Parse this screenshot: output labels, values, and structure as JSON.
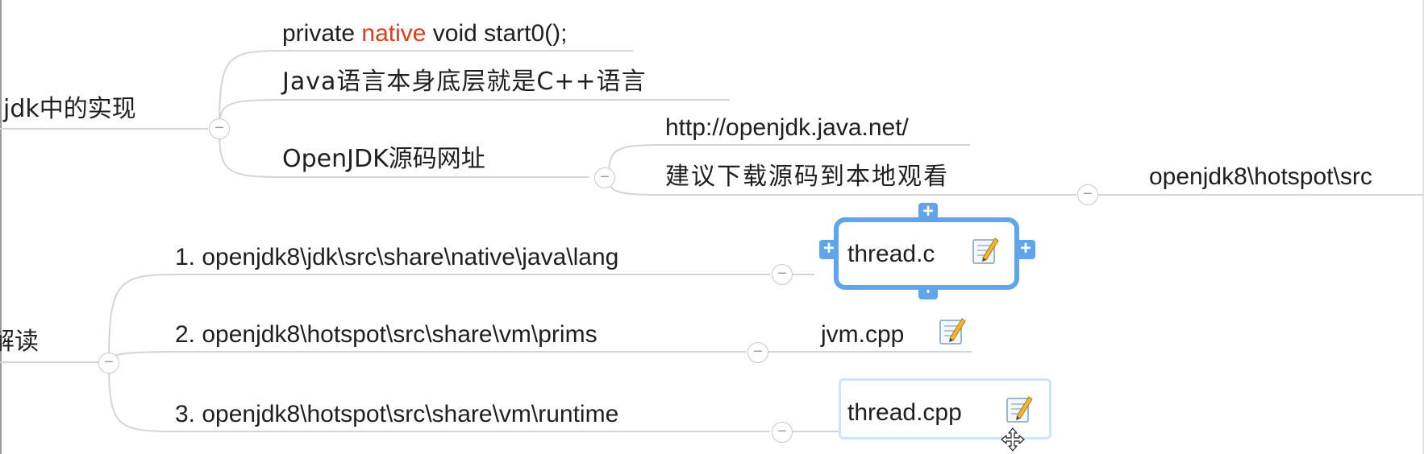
{
  "root_branches": {
    "jdk_impl": "jdk中的实现",
    "jiedu": "解读"
  },
  "jdk_impl_children": {
    "native_decl": {
      "prefix": "private ",
      "keyword": "native",
      "suffix": " void start0();"
    },
    "java_cpp": "Java语言本身底层就是C++语言",
    "openjdk_source": "OpenJDK源码网址"
  },
  "openjdk_children": {
    "url": "http://openjdk.java.net/",
    "download_tip": "建议下载源码到本地观看"
  },
  "download_child": "openjdk8\\hotspot\\src",
  "jiedu_children": [
    {
      "label": "1. openjdk8\\jdk\\src\\share\\native\\java\\lang",
      "file": "thread.c"
    },
    {
      "label": "2. openjdk8\\hotspot\\src\\share\\vm\\prims",
      "file": "jvm.cpp"
    },
    {
      "label": "3. openjdk8\\hotspot\\src\\share\\vm\\runtime",
      "file": "thread.cpp"
    }
  ],
  "collapse_symbol": "−",
  "add_symbol": "+",
  "colors": {
    "keyword": "#e03c1e",
    "selection": "#5ea5ec",
    "hover": "#cfe5fb",
    "connector": "#d2d2d2"
  },
  "icons": {
    "note": "note-icon",
    "move_cursor": "move-cursor-icon"
  }
}
